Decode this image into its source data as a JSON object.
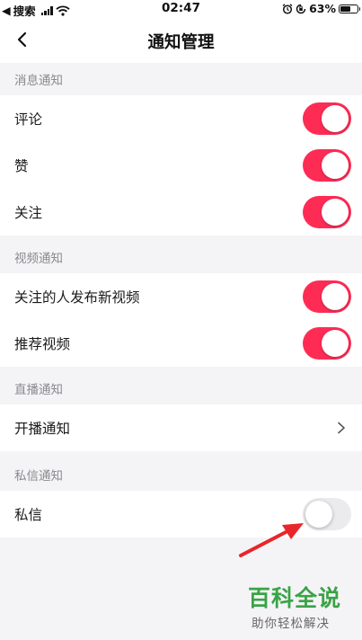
{
  "status_bar": {
    "back_app": "搜索",
    "time": "02:47",
    "battery": "63%",
    "battery_level": 0.63
  },
  "nav": {
    "title": "通知管理",
    "back_icon": "chevron-left-icon"
  },
  "sections": [
    {
      "header": "消息通知",
      "rows": [
        {
          "label": "评论",
          "toggle": true
        },
        {
          "label": "赞",
          "toggle": true
        },
        {
          "label": "关注",
          "toggle": true
        }
      ]
    },
    {
      "header": "视频通知",
      "rows": [
        {
          "label": "关注的人发布新视频",
          "toggle": true
        },
        {
          "label": "推荐视频",
          "toggle": true
        }
      ]
    },
    {
      "header": "直播通知",
      "rows": [
        {
          "label": "开播通知",
          "control": "chevron-right-icon"
        }
      ]
    },
    {
      "header": "私信通知",
      "rows": [
        {
          "label": "私信",
          "toggle": false
        }
      ]
    }
  ],
  "colors": {
    "accent": "#fe2c55",
    "toggle_off": "#ebebee",
    "arrow": "#e8262a",
    "watermark": "#3aa346"
  },
  "watermark": {
    "title": "百科全说",
    "subtitle": "助你轻松解决"
  }
}
